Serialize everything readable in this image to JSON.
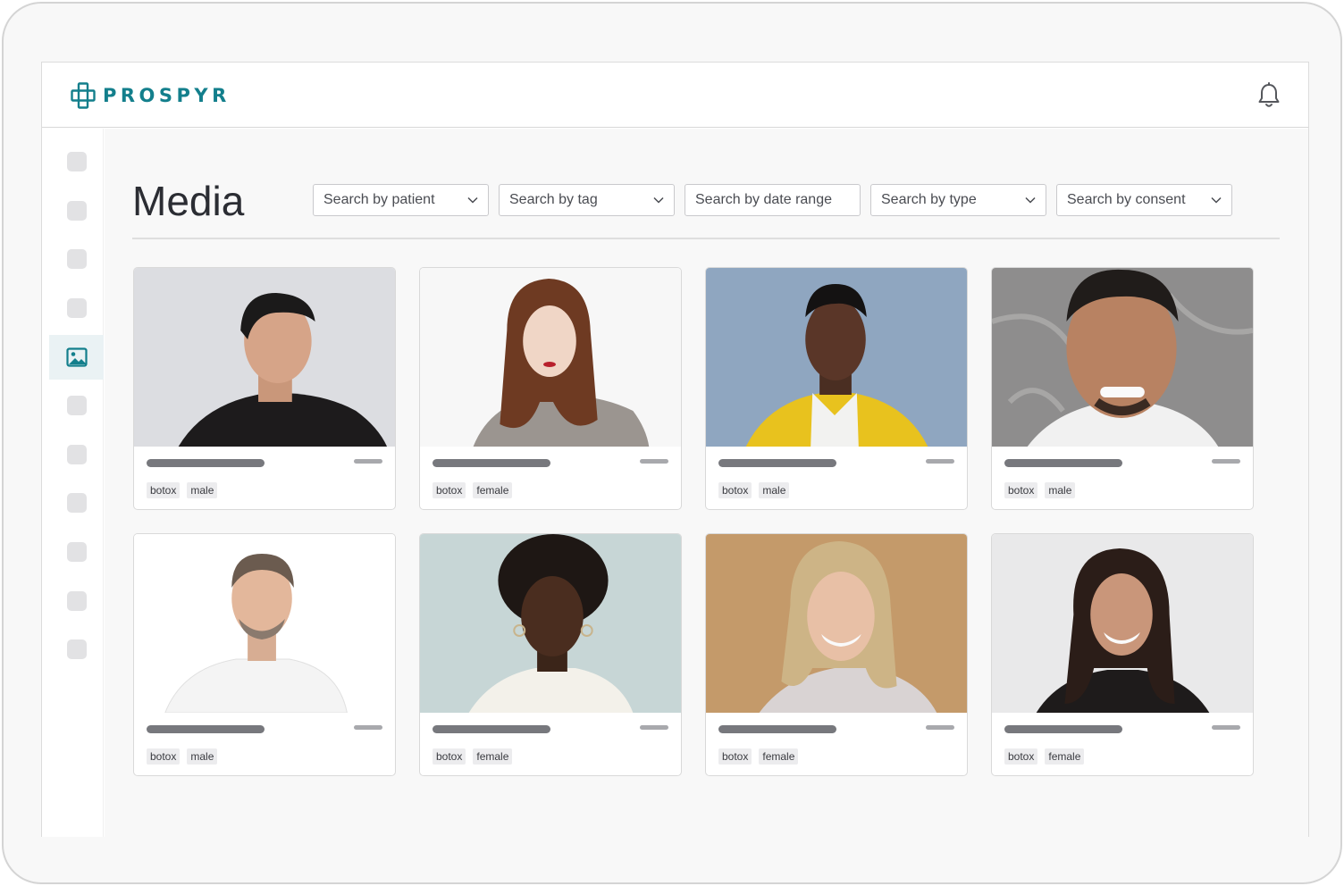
{
  "header": {
    "brand": "PROSPYR",
    "notification_icon": "bell-icon",
    "brand_color": "#137f8c"
  },
  "sidebar": {
    "items": [
      {
        "icon": "nav-placeholder-icon"
      },
      {
        "icon": "nav-placeholder-icon"
      },
      {
        "icon": "nav-placeholder-icon"
      },
      {
        "icon": "nav-placeholder-icon"
      },
      {
        "icon": "image-icon",
        "active": true
      },
      {
        "icon": "nav-placeholder-icon"
      },
      {
        "icon": "nav-placeholder-icon"
      },
      {
        "icon": "nav-placeholder-icon"
      },
      {
        "icon": "nav-placeholder-icon"
      },
      {
        "icon": "nav-placeholder-icon"
      },
      {
        "icon": "nav-placeholder-icon"
      }
    ],
    "active_color": "#eaf2f4"
  },
  "main": {
    "title": "Media",
    "filters": [
      {
        "label": "Search by patient",
        "dropdown": true
      },
      {
        "label": "Search by tag",
        "dropdown": true
      },
      {
        "label": "Search by date range",
        "dropdown": false
      },
      {
        "label": "Search by type",
        "dropdown": true
      },
      {
        "label": "Search by consent",
        "dropdown": true
      }
    ],
    "cards": [
      {
        "tags": [
          "botox",
          "male"
        ]
      },
      {
        "tags": [
          "botox",
          "female"
        ]
      },
      {
        "tags": [
          "botox",
          "male"
        ]
      },
      {
        "tags": [
          "botox",
          "male"
        ]
      },
      {
        "tags": [
          "botox",
          "male"
        ]
      },
      {
        "tags": [
          "botox",
          "female"
        ]
      },
      {
        "tags": [
          "botox",
          "female"
        ]
      },
      {
        "tags": [
          "botox",
          "female"
        ]
      }
    ]
  }
}
